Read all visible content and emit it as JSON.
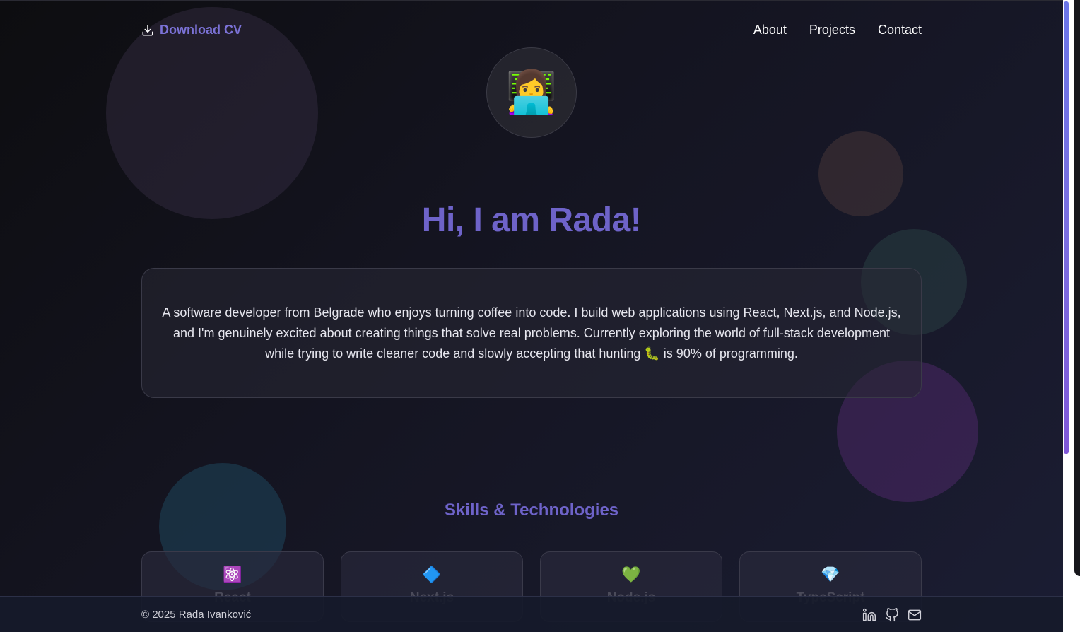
{
  "nav": {
    "download_label": "Download CV",
    "links": [
      "About",
      "Projects",
      "Contact"
    ]
  },
  "avatar": {
    "emoji": "👩‍💻"
  },
  "hero": {
    "title": "Hi, I am Rada!",
    "bio": "A software developer from Belgrade who enjoys turning coffee into code. I build web applications using React, Next.js, and Node.js, and I'm genuinely excited about creating things that solve real problems. Currently exploring the world of full-stack development while trying to write cleaner code and slowly accepting that hunting 🐛 is 90% of programming."
  },
  "skills": {
    "title": "Skills & Technologies",
    "items": [
      {
        "icon": "⚛️",
        "name": "React"
      },
      {
        "icon": "🔷",
        "name": "Next.js"
      },
      {
        "icon": "💚",
        "name": "Node.js"
      },
      {
        "icon": "💎",
        "name": "TypeScript"
      }
    ]
  },
  "footer": {
    "copyright": "© 2025 Rada Ivanković",
    "icons": [
      "linkedin-icon",
      "github-icon",
      "mail-icon"
    ]
  },
  "colors": {
    "accent": "#6e63c9",
    "link_accent": "#7b72d6",
    "background": "#141420"
  }
}
